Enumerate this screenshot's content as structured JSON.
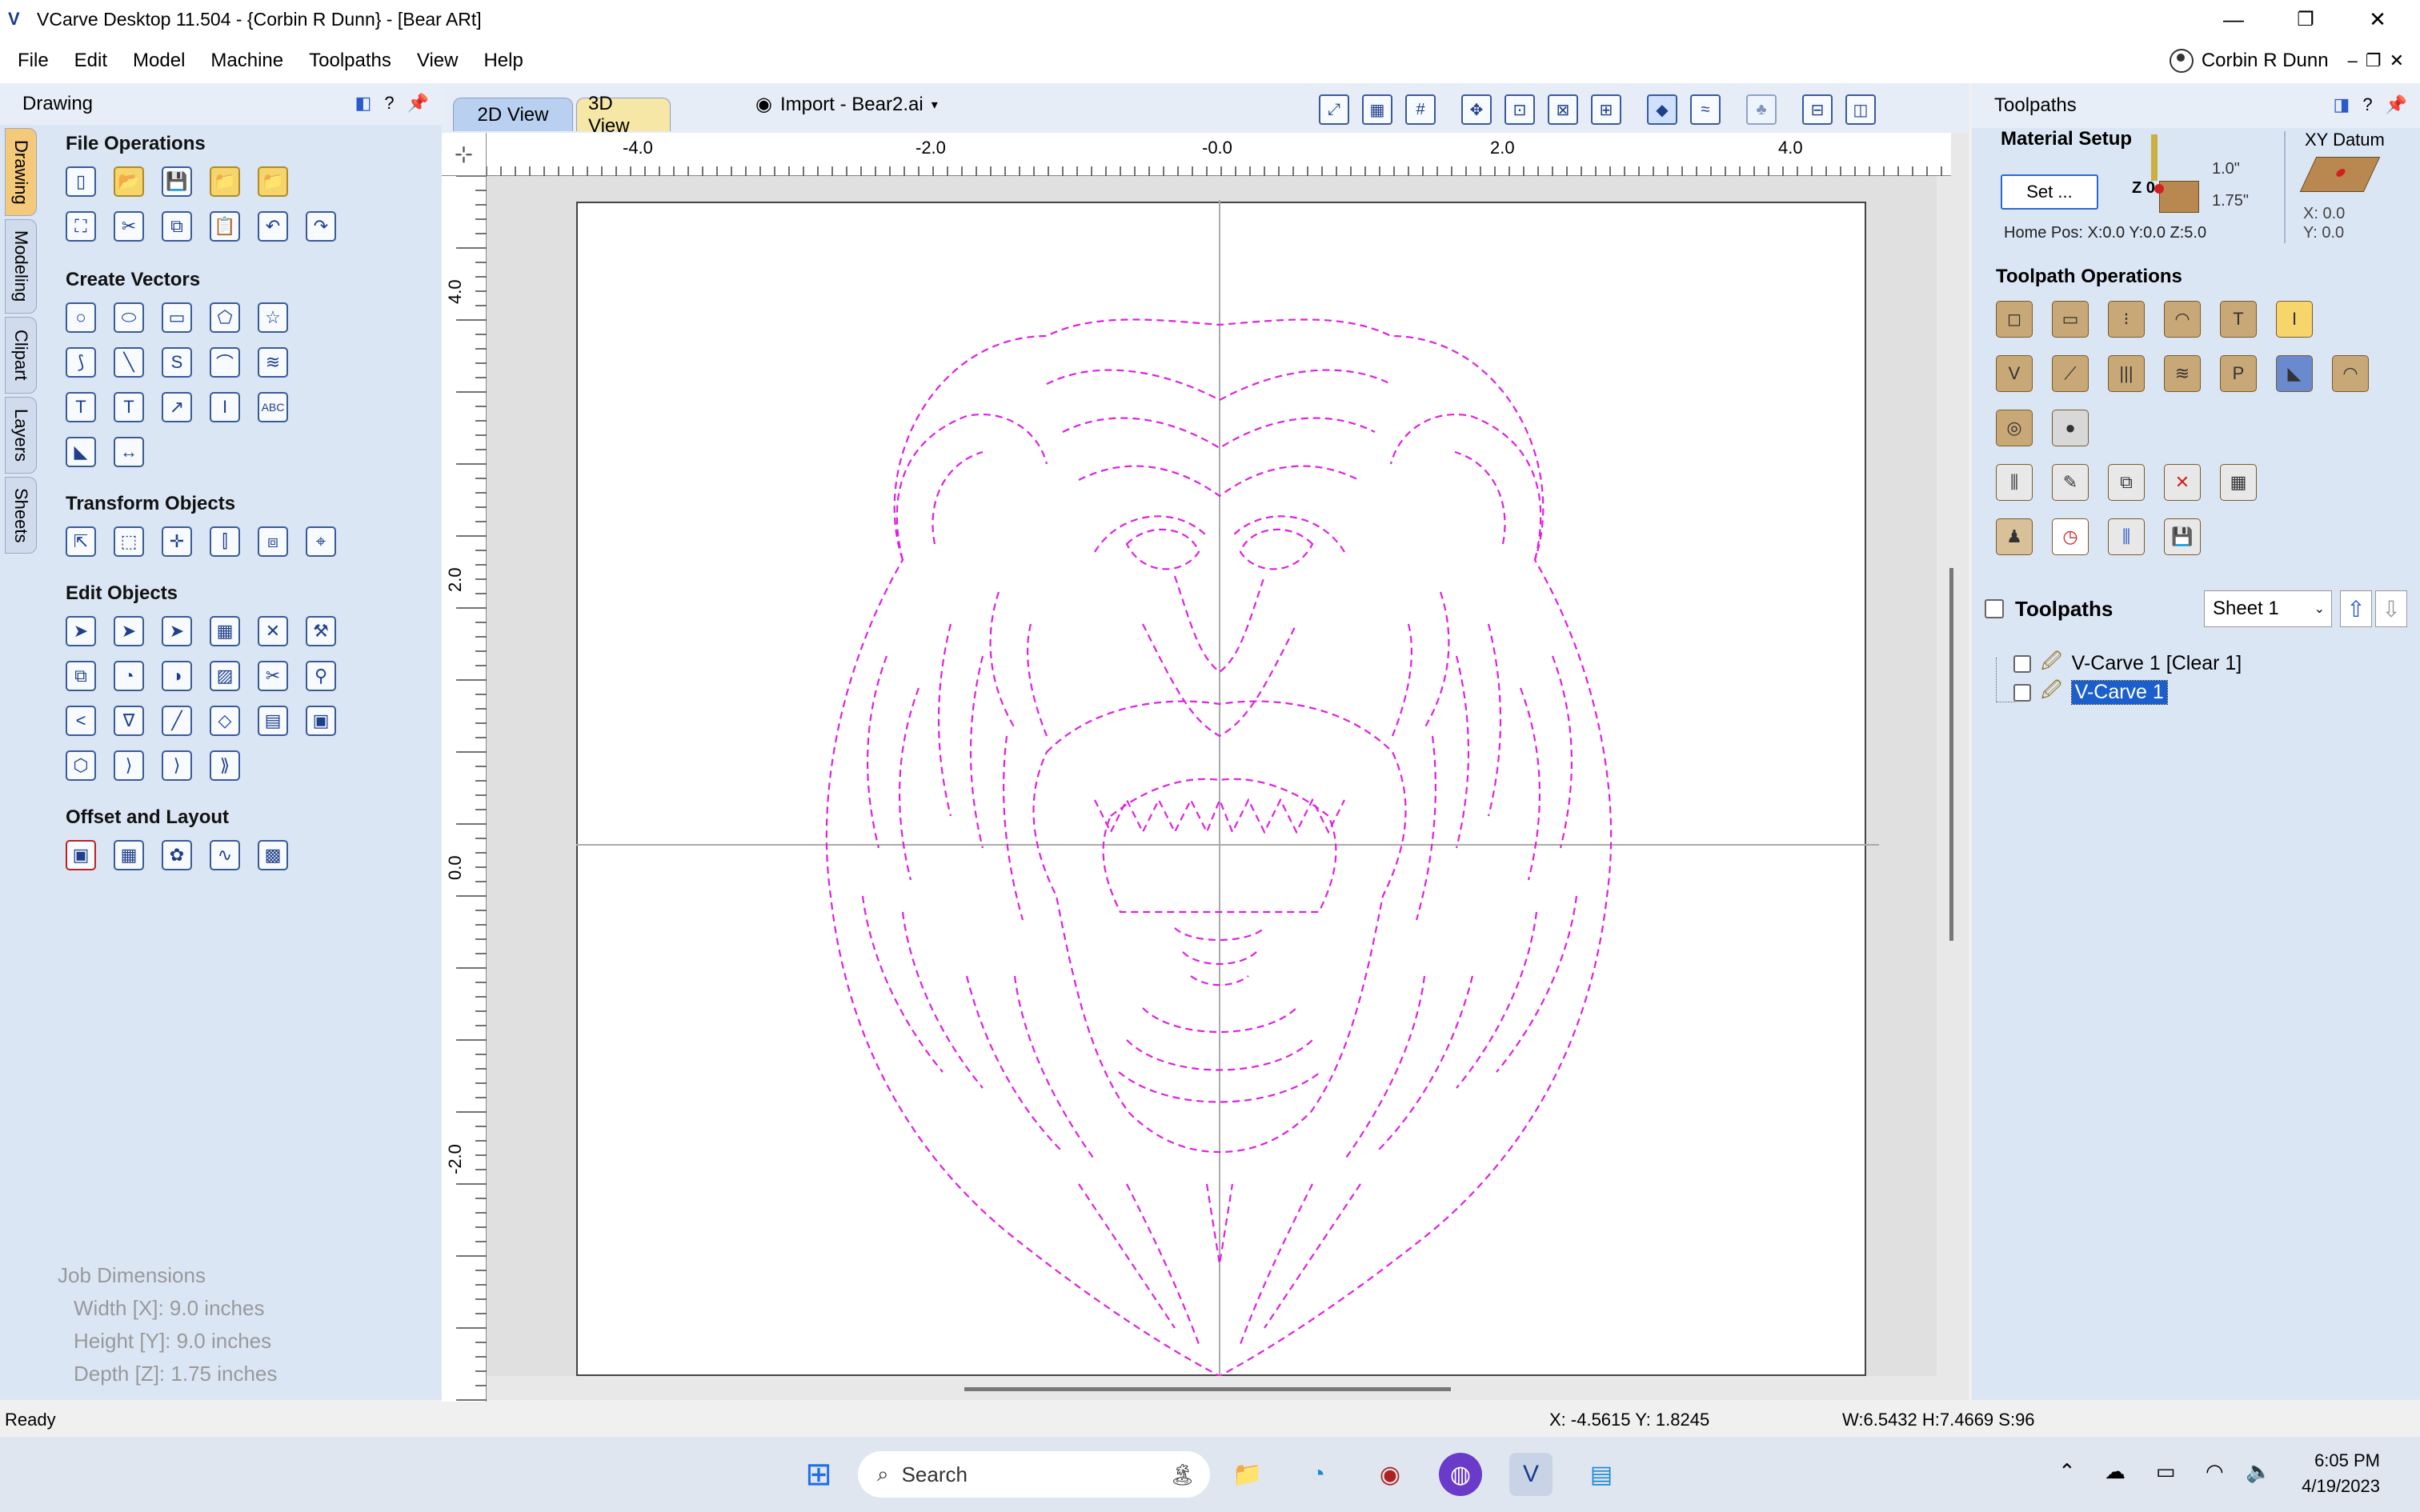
{
  "window": {
    "title": "VCarve Desktop 11.504 - {Corbin R Dunn} - [Bear ARt]",
    "minimize": "—",
    "maximize": "❐",
    "close": "✕"
  },
  "menu": {
    "items": [
      "File",
      "Edit",
      "Model",
      "Machine",
      "Toolpaths",
      "View",
      "Help"
    ],
    "user": "Corbin R Dunn"
  },
  "left_panel": {
    "title": "Drawing",
    "tabs": [
      "Drawing",
      "Modeling",
      "Clipart",
      "Layers",
      "Sheets"
    ],
    "sections": {
      "file_ops": "File Operations",
      "create_vectors": "Create Vectors",
      "transform": "Transform Objects",
      "edit": "Edit Objects",
      "offset": "Offset and Layout"
    },
    "job": {
      "heading": "Job Dimensions",
      "width": "Width  [X]: 9.0 inches",
      "height": "Height [Y]: 9.0 inches",
      "depth": "Depth  [Z]: 1.75 inches"
    }
  },
  "view": {
    "tab_2d": "2D View",
    "tab_3d": "3D View",
    "import_label": "Import - Bear2.ai",
    "ruler_x": [
      "-4.0",
      "-2.0",
      "-0.0",
      "2.0",
      "4.0"
    ],
    "ruler_y": [
      "4.0",
      "2.0",
      "0.0",
      "-2.0"
    ],
    "drawing_color": "#e020e0"
  },
  "right_panel": {
    "title": "Toolpaths",
    "material_setup": "Material Setup",
    "set_button": "Set ...",
    "dim_top": "1.0\"",
    "dim_bottom": "1.75\"",
    "z_label": "Z 0",
    "home_pos": "Home Pos:  X:0.0 Y:0.0 Z:5.0",
    "xy_datum": "XY Datum",
    "xy_x": "X: 0.0",
    "xy_y": "Y: 0.0",
    "toolpath_ops": "Toolpath Operations",
    "toolpaths_label": "Toolpaths",
    "sheet": "Sheet 1",
    "items": [
      "V-Carve 1 [Clear 1]",
      "V-Carve 1"
    ]
  },
  "status": {
    "left": "Ready",
    "coords": "X: -4.5615 Y:  1.8245",
    "dims": "W:6.5432   H:7.4669  S:96"
  },
  "taskbar": {
    "search": "Search",
    "time": "6:05 PM",
    "date": "4/19/2023"
  }
}
